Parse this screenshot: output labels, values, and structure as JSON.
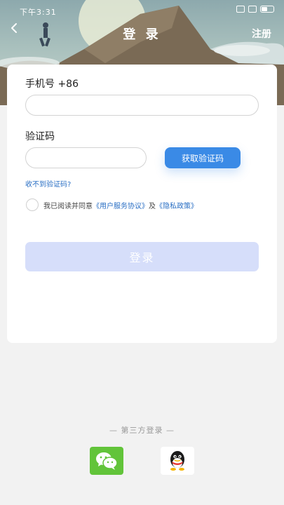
{
  "status_bar": {
    "left_text": "下午3:31",
    "network_icons": [
      "signal-icon",
      "wifi-icon",
      "battery-icon"
    ]
  },
  "nav": {
    "back_icon": "back-arrow-icon",
    "title": "登 录",
    "register_label": "注册"
  },
  "form": {
    "phone_label": "手机号 +86",
    "phone_value": "",
    "phone_placeholder": "",
    "code_label": "验证码",
    "code_value": "",
    "code_placeholder": "",
    "get_code_label": "获取验证码",
    "no_code_label": "收不到验证码?",
    "agree_prefix": "我已阅读并同意",
    "agree_user_agreement": "《用户服务协议》",
    "agree_and": "及",
    "agree_privacy": "《隐私政策》",
    "agree_checked": false,
    "login_label": "登录"
  },
  "third_party": {
    "title": "— 第三方登录 —",
    "options": [
      "wechat-icon",
      "qq-icon"
    ]
  },
  "colors": {
    "primary": "#3a8ae6",
    "login_disabled": "#d6defa",
    "link": "#2a6fc4",
    "wechat": "#62c43a",
    "background": "#f2f2f2"
  }
}
